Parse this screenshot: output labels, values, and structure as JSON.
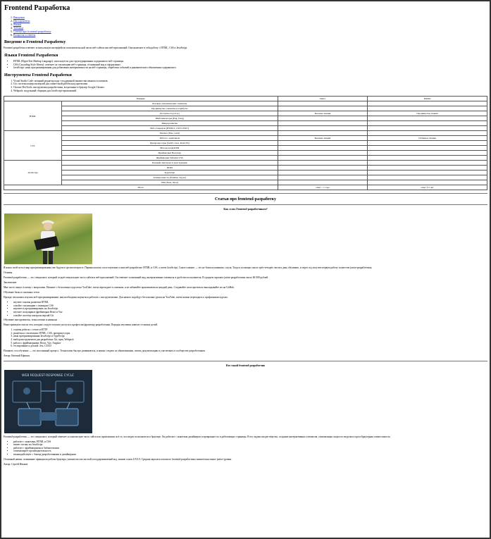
{
  "title": "Frontend Разработка",
  "toc": [
    "Введение",
    "Инструменты",
    "Языки",
    "Таблица",
    "Статьи про frontend-разработку",
    "Вопросы и ответы"
  ],
  "intro": {
    "heading": "Введение в Frontend Разработку",
    "text": "Frontend разработка отвечает за визуальную интерфейсов пользовательской части веб-сайтов или веб-приложений. Она включает в себя работу с HTML, CSS и JavaScript."
  },
  "languages": {
    "heading": "Языки Frontend Разработки",
    "items": [
      "HTML (HyperText Markup Language): используется для структурирования содержимого веб-страницы.",
      "CSS (Cascading Style Sheets): отвечает за стилизацию веб-страницы, её внешний вид и оформление.",
      "JavaScript: язык программирования для добавления интерактивности на веб-страницы, обработки событий и динамического обновления содержимого."
    ]
  },
  "tools": {
    "heading": "Инструменты Frontend Разработки",
    "items": [
      "Visual Studio Code: мощный редактор кода с поддержкой множества языков и плагинов.",
      "Git: система контроля версий для совместной работы над проектами.",
      "Chrome DevTools: инструменты разработчика, встроенные в браузер Google Chrome.",
      "Webpack: модульный сборщик для JavaScript-приложений."
    ]
  },
  "table": {
    "headers": [
      "Навыки",
      "",
      "Junior",
      "Middle"
    ],
    "groups": [
      {
        "name": "HTML",
        "rows": [
          [
            "Базовые семантические элементы",
            "",
            ""
          ],
          [
            "Продвинутые элементы и атрибуты",
            "",
            ""
          ],
          [
            "Доступность (a11y)",
            "Базовые знания",
            "Продвинутые знания"
          ],
          [
            "Шаблонизаторы (Pug, Twig)",
            "",
            ""
          ],
          [
            "Микроразметка",
            "",
            ""
          ],
          [
            "Веб-стандарты (HTML5, CSS3, ES6+)",
            "",
            ""
          ]
        ]
      },
      {
        "name": "CSS",
        "rows": [
          [
            "Flexbox (Flex, Grid)",
            "",
            ""
          ],
          [
            "Работа с адаптивом",
            "Базовые знания",
            "Отличное знание"
          ],
          [
            "Препроцессоры (SASS, Less, PostCSS)",
            "",
            ""
          ],
          [
            "Методология БЭМ",
            "",
            ""
          ],
          [
            "Фреймворки Bootstrap",
            "",
            ""
          ],
          [
            "Фреймворки Tailwind CSS",
            "",
            ""
          ]
        ]
      },
      {
        "name": "JavaScript",
        "rows": [
          [
            "Базовый синтаксис и конструкции",
            "",
            ""
          ],
          [
            "DOM",
            "",
            ""
          ],
          [
            "TypeScript",
            "",
            ""
          ],
          [
            "Асинхронность (Promise, Async)",
            "",
            ""
          ],
          [
            "SSR (Next, Nuxt)",
            "",
            ""
          ]
        ]
      }
    ],
    "footer": [
      "Итого",
      "опыт ~ 1 года",
      "опыт 3-5 лет"
    ]
  },
  "articles": {
    "heading": "Статьи про frontend-разработку",
    "a1": {
      "title": "Как стать Frontend-разработчиком?",
      "p1": "Я начал свой путь в мир программирования уже будучи в зрелом возрасте. Первым шагом стало изучение основ веб-разработки: HTML и CSS, а затем JavaScript. Самое главное — это не бояться начинать с нуля. Тогда я посвящал около трёх-четырёх часов в день обучению, и через год получил первую работу в качестве junior-разработчика.",
      "q1": "Отзывы",
      "p2": "Frontend-разработчик — это специалист, который создаёт визуальную часть сайтов и веб-приложений. Он отвечает за внешний вид, интерактивные элементы и удобство пользователя. В среднем зарплата junior-разработчика около 60 000 рублей.",
      "q2": "Заключение",
      "p3": "Мне часто пишут в личку с вопросами. Начните с бесплатных курсов на YouTube, затем переходите к платным, и не забывайте практиковаться каждый день. Создавайте свои проекты и выкладывайте их на GitHub.",
      "q3": "Обучение базы и основных тегов",
      "p4": "Прежде чем начать изучать веб-программирование, вам необходимо научиться работать с инструментами. Для начала подойдут бесплатные уроки на YouTube, затем можно переходить к профильным курсам.",
      "list1": [
        "изучите основы разметки HTML",
        "освойте стилизацию с помощью CSS",
        "научитесь программировать на JavaScript",
        "изучите популярные фреймворки React и Vue",
        "освойте систему контроля версий Git"
      ],
      "q4": "Обучение инструментам, технологиям и навыкам",
      "p5": "Ниже приведён список тем, которые следует изучить на пути к профессии фронтенд-разработчика. Порядок изучения зависит от ваших целей.",
      "list2": [
        "основы работы с сетью и HTTP",
        "разметка и стилизация: HTML, CSS, препроцессоры",
        "язык программирования JavaScript и TypeScript",
        "выбор инструментов для разработки: Git, npm, Webpack",
        "работа с фреймворками: React, Vue, Angular",
        "тестирование и деплой: Jest, CI/CD"
      ],
      "p6": "Помните, что обучение — это постоянный процесс. Технологии быстро развиваются, и важно следить за обновлениями, читать документацию и участвовать в сообществе разработчиков.",
      "author": "Автор: Евгений Ефимов"
    },
    "a2": {
      "title": "Кто такой frontend-разработчик",
      "p1": "Frontend-разработчик — это специалист, который отвечает за клиентскую часть сайта или приложения: всё то, что видит пользователь в браузере. Он работает с макетами дизайнеров и превращает их в работающие страницы. В его задачи входит вёрстка, создание интерактивных элементов, оптимизация скорости загрузки и кроссбраузерная совместимость.",
      "list": [
        "работает с макетами, HTML и CSS",
        "пишет логику на JavaScript",
        "работает с фреймворками и библиотеками",
        "оптимизирует производительность",
        "взаимодействует с бэкенд-разработчиками и дизайнерами"
      ],
      "p2": "Отличный навык: понимание принципов работы браузера, умение писать чистый и поддерживаемый код, знание основ UX/UI. Средняя зарплата опытного frontend-разработчика значительно выше junior-уровня.",
      "author": "Автор: Сергей Иванов"
    }
  },
  "diagram": {
    "caption": "WEB REQUEST-RESPONSE CYCLE"
  }
}
